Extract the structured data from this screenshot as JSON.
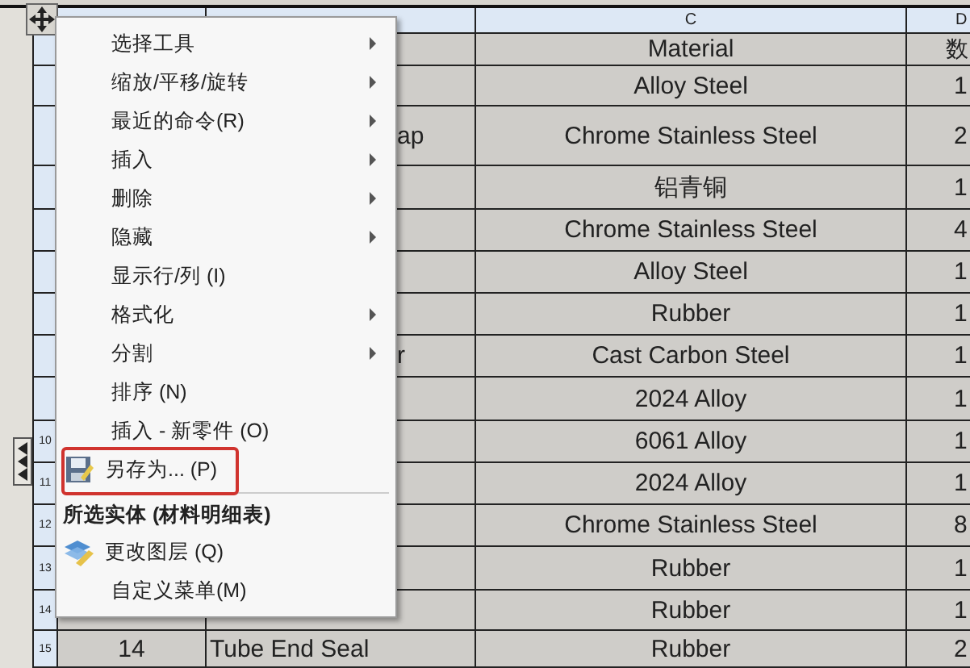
{
  "table": {
    "header": {
      "column_c": "C",
      "column_d": "D"
    },
    "rows": [
      {
        "column_c": "Material",
        "column_d": "数"
      },
      {
        "column_c": "Alloy Steel",
        "column_d": "1"
      },
      {
        "column_b": "ap",
        "column_c": "Chrome Stainless Steel",
        "column_d": "2"
      },
      {
        "column_c": "铝青铜",
        "column_d": "1"
      },
      {
        "column_c": "Chrome Stainless Steel",
        "column_d": "4"
      },
      {
        "column_c": "Alloy Steel",
        "column_d": "1"
      },
      {
        "column_c": "Rubber",
        "column_d": "1"
      },
      {
        "column_b": "r",
        "column_c": "Cast Carbon Steel",
        "column_d": "1"
      },
      {
        "column_c": "2024 Alloy",
        "column_d": "1"
      },
      {
        "row_number": "10",
        "column_c": "6061 Alloy",
        "column_d": "1"
      },
      {
        "row_number": "11",
        "column_c": "2024 Alloy",
        "column_d": "1"
      },
      {
        "row_number": "12",
        "column_c": "Chrome Stainless Steel",
        "column_d": "8"
      },
      {
        "row_number": "13",
        "column_c": "Rubber",
        "column_d": "1"
      },
      {
        "row_number": "14",
        "column_c": "Rubber",
        "column_d": "1"
      },
      {
        "row_number": "15",
        "column_a": "14",
        "column_b": "Tube End Seal",
        "column_c": "Rubber",
        "column_d": "2"
      }
    ]
  },
  "context_menu": {
    "items": [
      {
        "kind": "command",
        "label": "选择工具",
        "submenu": true
      },
      {
        "kind": "command",
        "label": "缩放/平移/旋转",
        "submenu": true
      },
      {
        "kind": "command",
        "label": "最近的命令(R)",
        "submenu": true
      },
      {
        "kind": "command",
        "label": "插入",
        "submenu": true
      },
      {
        "kind": "command",
        "label": "删除",
        "submenu": true
      },
      {
        "kind": "command",
        "label": "隐藏",
        "submenu": true
      },
      {
        "kind": "command",
        "label": "显示行/列 (I)",
        "submenu": false
      },
      {
        "kind": "command",
        "label": "格式化",
        "submenu": true
      },
      {
        "kind": "command",
        "label": "分割",
        "submenu": true
      },
      {
        "kind": "command",
        "label": "排序 (N)",
        "submenu": false
      },
      {
        "kind": "command",
        "label": "插入 - 新零件 (O)",
        "submenu": false
      },
      {
        "kind": "save",
        "label": "另存为... (P)",
        "submenu": false,
        "outlined": true
      },
      {
        "kind": "separator"
      },
      {
        "kind": "section",
        "label": "所选实体 (材料明细表)"
      },
      {
        "kind": "layers",
        "label": "更改图层 (Q)",
        "submenu": false
      },
      {
        "kind": "command",
        "label": "自定义菜单(M)",
        "submenu": false
      }
    ]
  }
}
